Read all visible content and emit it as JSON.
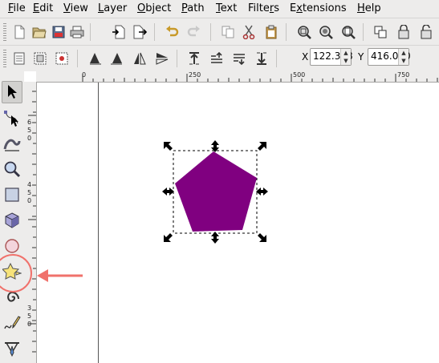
{
  "menubar": {
    "items": [
      "File",
      "Edit",
      "View",
      "Layer",
      "Object",
      "Path",
      "Text",
      "Filters",
      "Extensions",
      "Help"
    ],
    "underlines": [
      "F",
      "E",
      "V",
      "L",
      "O",
      "P",
      "T",
      "r",
      "x",
      "H"
    ]
  },
  "toolbar2": {
    "x_label": "X",
    "x_value": "122.358",
    "y_label": "Y",
    "y_value": "416.060"
  },
  "rulers": {
    "top": [
      "0",
      "250",
      "500",
      "750"
    ],
    "left": [
      "6",
      "5",
      "0",
      "4",
      "5",
      "0",
      "3",
      "5",
      "0"
    ]
  },
  "colors": {
    "pentagon_fill": "#800080",
    "annotation": "#f0716b"
  },
  "tools": [
    "selector-tool",
    "node-tool",
    "tweak-tool",
    "zoom-tool",
    "rectangle-tool",
    "3d-box-tool",
    "ellipse-tool",
    "star-polygon-tool",
    "spiral-tool",
    "pencil-tool",
    "pen-tool"
  ],
  "active_tool": "star-polygon-tool"
}
